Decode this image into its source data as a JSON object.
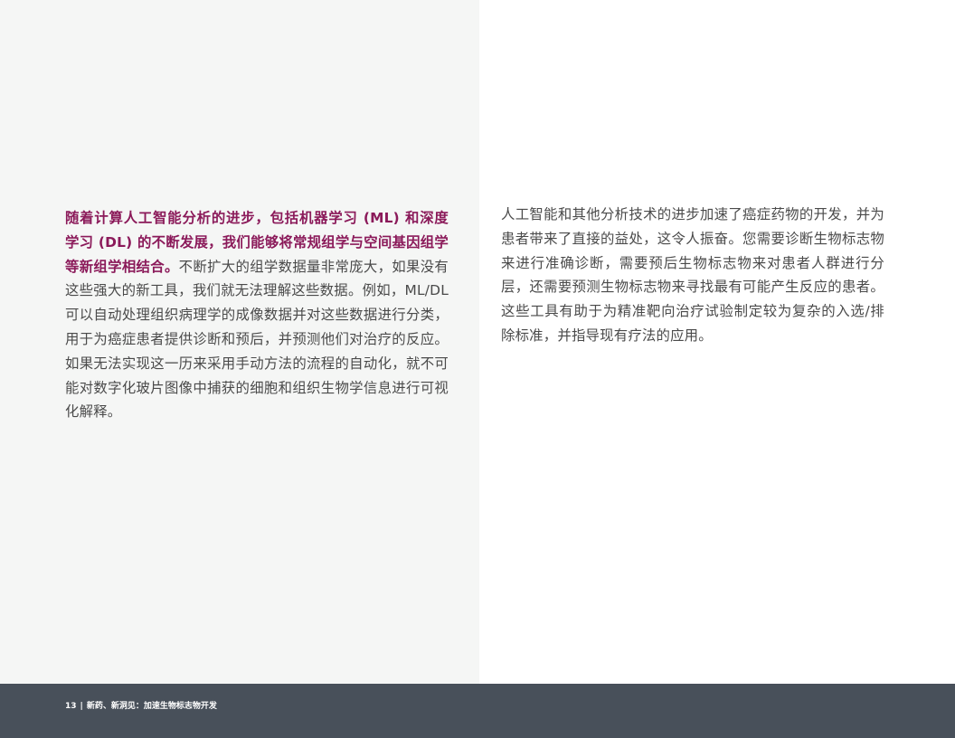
{
  "left_column": {
    "lead": "随着计算人工智能分析的进步，包括机器学习 (ML) 和深度学习 (DL) 的不断发展，我们能够将常规组学与空间基因组学等新组学相结合。",
    "body": "不断扩大的组学数据量非常庞大，如果没有这些强大的新工具，我们就无法理解这些数据。例如，ML/DL 可以自动处理组织病理学的成像数据并对这些数据进行分类，用于为癌症患者提供诊断和预后，并预测他们对治疗的反应。如果无法实现这一历来采用手动方法的流程的自动化，就不可能对数字化玻片图像中捕获的细胞和组织生物学信息进行可视化解释。"
  },
  "right_column": {
    "body": "人工智能和其他分析技术的进步加速了癌症药物的开发，并为患者带来了直接的益处，这令人振奋。您需要诊断生物标志物来进行准确诊断，需要预后生物标志物来对患者人群进行分层，还需要预测生物标志物来寻找最有可能产生反应的患者。这些工具有助于为精准靶向治疗试验制定较为复杂的入选/排除标准，并指导现有疗法的应用。"
  },
  "footer": {
    "page_number": "13",
    "separator": "|",
    "title": "新药、新洞见：加速生物标志物开发"
  },
  "colors": {
    "accent": "#8b1a5a",
    "body_text": "#4a4a4a",
    "left_background": "#f5f6f5",
    "footer_background": "#48505a"
  }
}
